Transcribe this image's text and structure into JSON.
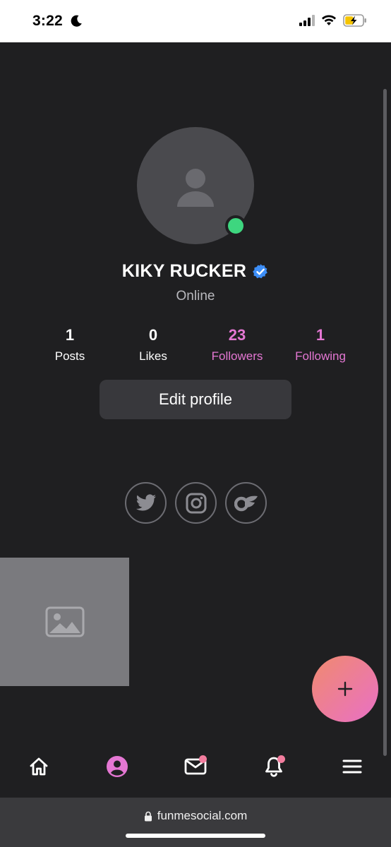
{
  "status_bar": {
    "time": "3:22",
    "icons": [
      "moon-icon",
      "signal-icon",
      "wifi-icon",
      "battery-charging-icon"
    ]
  },
  "profile": {
    "name": "KIKY RUCKER",
    "verified": true,
    "status": "Online",
    "online_indicator_color": "#3ed67f"
  },
  "stats": [
    {
      "value": "1",
      "label": "Posts",
      "highlight": false
    },
    {
      "value": "0",
      "label": "Likes",
      "highlight": false
    },
    {
      "value": "23",
      "label": "Followers",
      "highlight": true
    },
    {
      "value": "1",
      "label": "Following",
      "highlight": true
    }
  ],
  "actions": {
    "edit_profile_label": "Edit profile"
  },
  "socials": [
    "twitter-icon",
    "instagram-icon",
    "onlyfans-icon"
  ],
  "fab": {
    "label": "+"
  },
  "bottom_nav": [
    {
      "name": "home-icon",
      "active": false,
      "badge": false
    },
    {
      "name": "profile-icon",
      "active": true,
      "badge": false
    },
    {
      "name": "messages-icon",
      "active": false,
      "badge": true
    },
    {
      "name": "notifications-icon",
      "active": false,
      "badge": true
    },
    {
      "name": "menu-icon",
      "active": false,
      "badge": false
    }
  ],
  "browser": {
    "url": "funmesocial.com"
  },
  "colors": {
    "background": "#1f1f21",
    "accent_pink": "#e477d3",
    "badge": "#f27d9e",
    "fab_gradient": [
      "#f08a6e",
      "#e970c6"
    ]
  }
}
